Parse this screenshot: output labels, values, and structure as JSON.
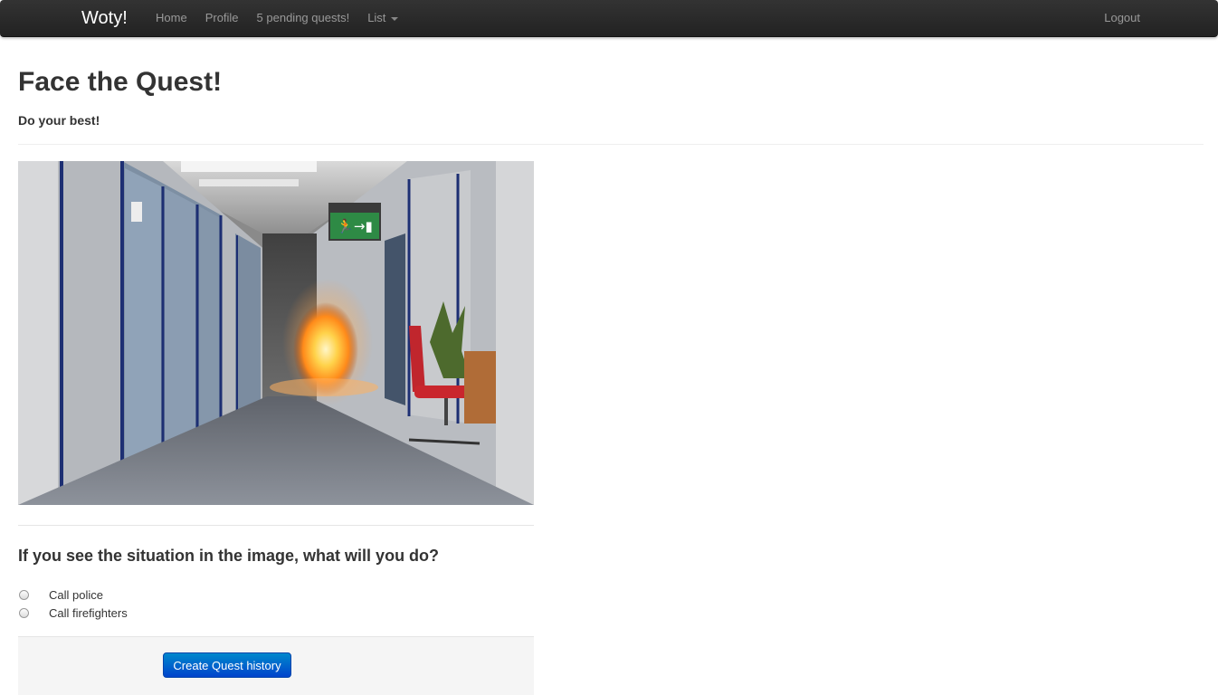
{
  "navbar": {
    "brand": "Woty!",
    "links": [
      "Home",
      "Profile",
      "5 pending quests!"
    ],
    "dropdown_label": "List",
    "logout": "Logout"
  },
  "page": {
    "title": "Face the Quest!",
    "subtitle": "Do your best!"
  },
  "quest": {
    "question": "If you see the situation in the image, what will you do?",
    "options": [
      "Call police",
      "Call firefighters"
    ],
    "selected": null,
    "submit_label": "Create Quest history"
  },
  "image": {
    "subject": "office-corridor-fire-with-exit-sign"
  }
}
